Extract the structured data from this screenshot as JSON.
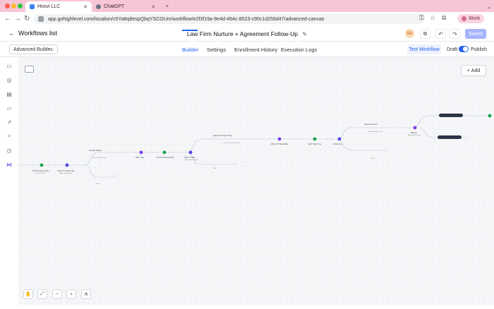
{
  "browser": {
    "tabs": [
      {
        "label": "Hosvi LLC",
        "active": true
      },
      {
        "label": "ChatGPT",
        "active": false
      }
    ],
    "new_tab": "+",
    "url": "app.gohighlevel.com/location/c5Ya8q8espQbqYSCOUm/workflow/e2f3f19a-9e4d-464c-8023-c90c1d256d47/advanced-canvas",
    "profile_label": "Work"
  },
  "header": {
    "back_label": "Workflows list",
    "title": "Law Firm Nurture + Agreement Follow-Up",
    "avatar_initials": "SA",
    "save_label": "Saved"
  },
  "subbar": {
    "builder_select": "Advanced Builder",
    "tabs": [
      "Builder",
      "Settings",
      "Enrollment History",
      "Execution Logs"
    ],
    "active_tab": "Builder",
    "test_label": "Test Workflow",
    "draft_label": "Draft",
    "publish_label": "Publish",
    "published": true
  },
  "canvas": {
    "add_label": "Add",
    "accent_color": "#4f46e5"
  },
  "colors": {
    "browser_chrome": "#f7c6d6",
    "primary": "#2563eb",
    "save_disabled": "#a5b4fc"
  },
  "sidebar_icons": [
    "chat-icon",
    "check-circle-icon",
    "document-icon",
    "folder-icon",
    "external-link-icon",
    "search-icon",
    "clock-icon",
    "workflow-icon"
  ]
}
